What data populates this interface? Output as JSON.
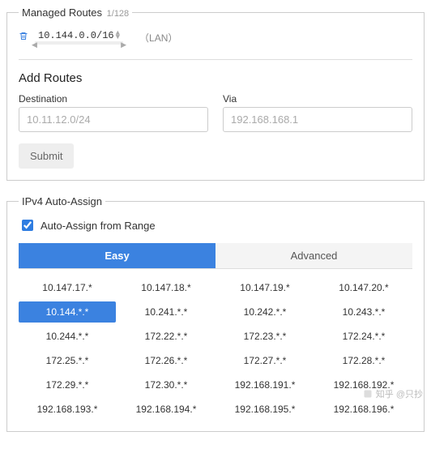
{
  "managedRoutes": {
    "legend": "Managed Routes",
    "count": "1/128",
    "entries": [
      {
        "cidr": "10.144.0.0/16",
        "note": "（LAN）"
      }
    ]
  },
  "addRoutes": {
    "title": "Add Routes",
    "destLabel": "Destination",
    "destPlaceholder": "10.11.12.0/24",
    "viaLabel": "Via",
    "viaPlaceholder": "192.168.168.1",
    "submitLabel": "Submit"
  },
  "autoAssign": {
    "legend": "IPv4 Auto-Assign",
    "checkboxLabel": "Auto-Assign from Range",
    "checked": true,
    "tabs": {
      "easy": "Easy",
      "advanced": "Advanced",
      "active": "easy"
    },
    "selected": "10.144.*.*",
    "ranges": [
      "10.147.17.*",
      "10.147.18.*",
      "10.147.19.*",
      "10.147.20.*",
      "10.144.*.*",
      "10.241.*.*",
      "10.242.*.*",
      "10.243.*.*",
      "10.244.*.*",
      "172.22.*.*",
      "172.23.*.*",
      "172.24.*.*",
      "172.25.*.*",
      "172.26.*.*",
      "172.27.*.*",
      "172.28.*.*",
      "172.29.*.*",
      "172.30.*.*",
      "192.168.191.*",
      "192.168.192.*",
      "192.168.193.*",
      "192.168.194.*",
      "192.168.195.*",
      "192.168.196.*"
    ]
  },
  "watermark": "知乎 @只抄"
}
